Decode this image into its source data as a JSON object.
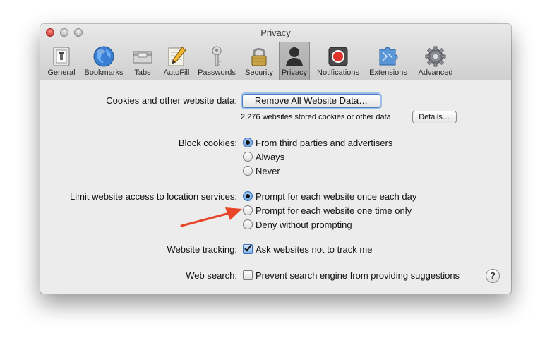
{
  "window": {
    "title": "Privacy"
  },
  "toolbar": {
    "items": [
      {
        "label": "General",
        "icon": "general-switch-icon"
      },
      {
        "label": "Bookmarks",
        "icon": "globe-icon"
      },
      {
        "label": "Tabs",
        "icon": "tabs-icon"
      },
      {
        "label": "AutoFill",
        "icon": "autofill-pencil-icon"
      },
      {
        "label": "Passwords",
        "icon": "key-icon"
      },
      {
        "label": "Security",
        "icon": "padlock-icon"
      },
      {
        "label": "Privacy",
        "icon": "person-silhouette-icon",
        "selected": true
      },
      {
        "label": "Notifications",
        "icon": "notifications-record-icon"
      },
      {
        "label": "Extensions",
        "icon": "puzzle-piece-icon"
      },
      {
        "label": "Advanced",
        "icon": "gear-icon"
      }
    ]
  },
  "cookies": {
    "label": "Cookies and other website data:",
    "remove_button": "Remove All Website Data…",
    "stored_text": "2,276 websites stored cookies or other data",
    "details_button": "Details…"
  },
  "block_cookies": {
    "label": "Block cookies:",
    "options": [
      {
        "label": "From third parties and advertisers",
        "selected": true
      },
      {
        "label": "Always",
        "selected": false
      },
      {
        "label": "Never",
        "selected": false
      }
    ]
  },
  "location": {
    "label": "Limit website access to location services:",
    "options": [
      {
        "label": "Prompt for each website once each day",
        "selected": true
      },
      {
        "label": "Prompt for each website one time only",
        "selected": false
      },
      {
        "label": "Deny without prompting",
        "selected": false
      }
    ]
  },
  "tracking": {
    "label": "Website tracking:",
    "checkbox_label": "Ask websites not to track me",
    "checked": true
  },
  "web_search": {
    "label": "Web search:",
    "checkbox_label": "Prevent search engine from providing suggestions",
    "checked": false,
    "help_label": "?"
  },
  "annotation": {
    "arrow_color": "#e8452a"
  }
}
